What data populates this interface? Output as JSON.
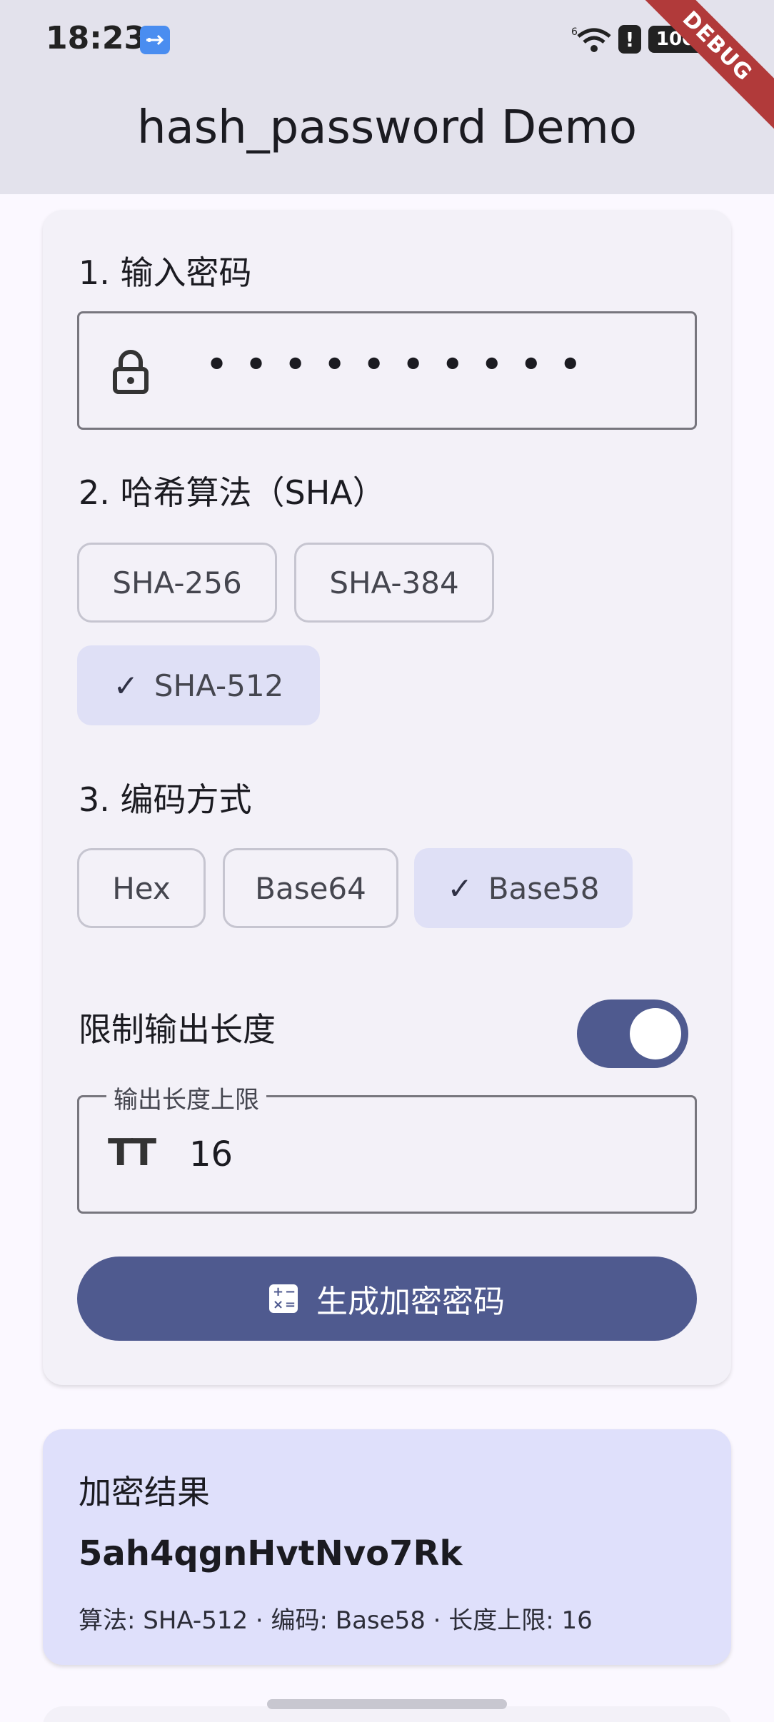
{
  "status_bar": {
    "time": "18:23",
    "signal_label": "6",
    "alert_label": "!",
    "battery_label": "100"
  },
  "debug_banner": "DEBUG",
  "app_bar": {
    "title": "hash_password Demo"
  },
  "form": {
    "password_section_title": "1. 输入密码",
    "password_value": "••••••••••",
    "hash_section_title": "2. 哈希算法（SHA）",
    "hash_options": [
      {
        "label": "SHA-256",
        "selected": false
      },
      {
        "label": "SHA-384",
        "selected": false
      },
      {
        "label": "SHA-512",
        "selected": true
      }
    ],
    "encoding_section_title": "3. 编码方式",
    "encoding_options": [
      {
        "label": "Hex",
        "selected": false
      },
      {
        "label": "Base64",
        "selected": false
      },
      {
        "label": "Base58",
        "selected": true
      }
    ],
    "limit_toggle_label": "限制输出长度",
    "limit_toggle_on": true,
    "length_field_label": "输出长度上限",
    "length_field_value": "16",
    "length_field_icon_glyph": "TT",
    "generate_button_label": "生成加密密码"
  },
  "result": {
    "title": "加密结果",
    "value": "5ah4qgnHvtNvo7Rk",
    "meta": "算法: SHA-512 · 编码: Base58 · 长度上限: 16"
  },
  "colors": {
    "primary": "#4f5a8f",
    "app_bar_bg": "#e3e2ec",
    "card_bg": "#f3f1f8",
    "selected_chip_bg": "#dfe0f6",
    "result_bg": "#dfe0fb"
  }
}
